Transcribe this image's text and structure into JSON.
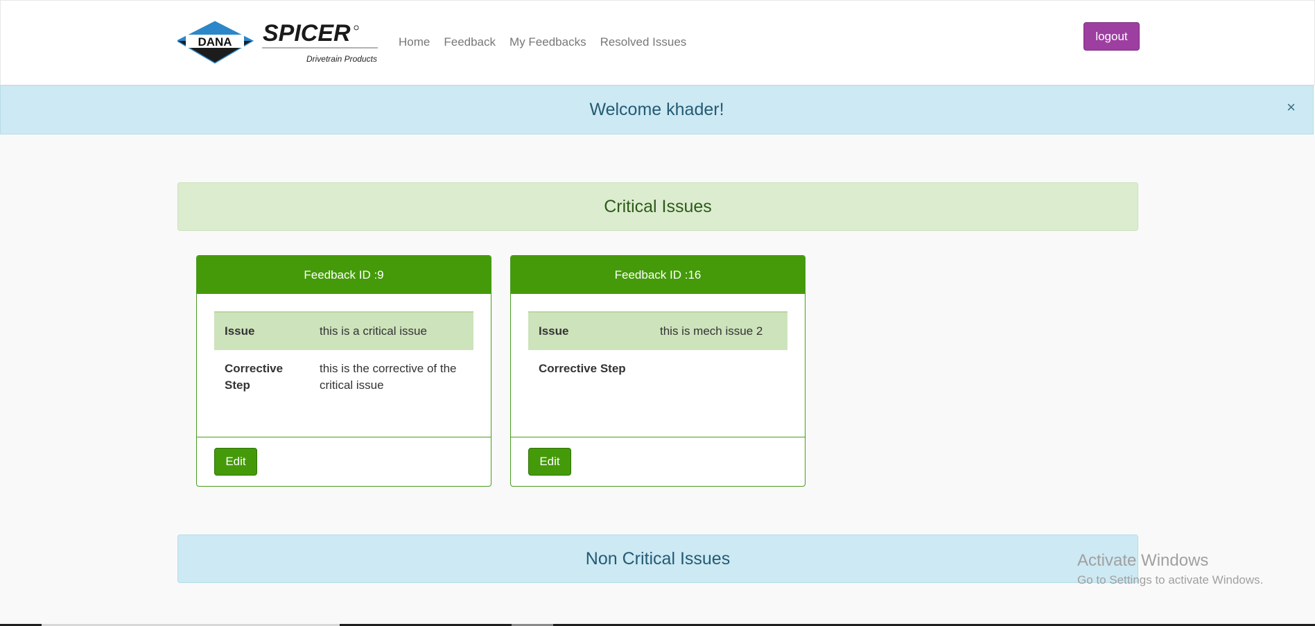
{
  "nav": {
    "logo_brand": "DANA",
    "logo_name": "SPICER",
    "logo_sub": "Drivetrain Products",
    "links": [
      "Home",
      "Feedback",
      "My Feedbacks",
      "Resolved Issues"
    ],
    "logout_label": "logout"
  },
  "alert": {
    "message": "Welcome khader!",
    "close": "×"
  },
  "critical": {
    "title": "Critical Issues",
    "cards": [
      {
        "header": "Feedback ID :9",
        "issue_label": "Issue",
        "issue_value": "this is a critical issue",
        "corrective_label": "Corrective Step",
        "corrective_value": "this is the corrective of the critical issue",
        "edit_label": "Edit"
      },
      {
        "header": "Feedback ID :16",
        "issue_label": "Issue",
        "issue_value": "this is mech issue 2",
        "corrective_label": "Corrective Step",
        "corrective_value": "",
        "edit_label": "Edit"
      }
    ]
  },
  "non_critical": {
    "title": "Non Critical Issues"
  },
  "watermark": {
    "title": "Activate Windows",
    "subtitle": "Go to Settings to activate Windows."
  },
  "colors": {
    "accent_green": "#459a0a",
    "logout_purple": "#9c3fa1",
    "info_blue": "#cde9f3",
    "success_light": "#dceccf"
  }
}
